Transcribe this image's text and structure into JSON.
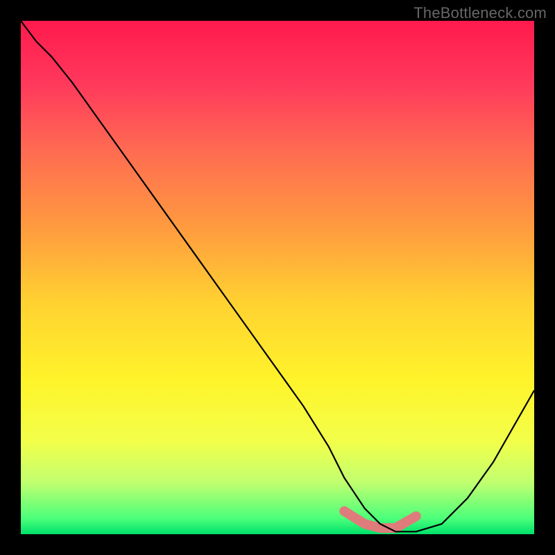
{
  "watermark": "TheBottleneck.com",
  "chart_data": {
    "type": "line",
    "title": "",
    "xlabel": "",
    "ylabel": "",
    "xlim": [
      0,
      100
    ],
    "ylim": [
      0,
      100
    ],
    "grid": false,
    "legend": "none",
    "annotations": [],
    "background_gradient": {
      "direction": "vertical",
      "stops": [
        {
          "pos": 0.0,
          "color": "#ff1a4d"
        },
        {
          "pos": 0.12,
          "color": "#ff385c"
        },
        {
          "pos": 0.25,
          "color": "#ff6a52"
        },
        {
          "pos": 0.4,
          "color": "#ff9a3f"
        },
        {
          "pos": 0.55,
          "color": "#ffd231"
        },
        {
          "pos": 0.7,
          "color": "#fff32a"
        },
        {
          "pos": 0.82,
          "color": "#f2ff4a"
        },
        {
          "pos": 0.9,
          "color": "#c0ff70"
        },
        {
          "pos": 0.97,
          "color": "#4aff7a"
        },
        {
          "pos": 1.0,
          "color": "#00e06a"
        }
      ]
    },
    "series": [
      {
        "name": "bottleneck-curve",
        "color": "#000000",
        "x": [
          0,
          3,
          6,
          10,
          15,
          20,
          25,
          30,
          35,
          40,
          45,
          50,
          55,
          60,
          63,
          67,
          70,
          73,
          77,
          82,
          87,
          92,
          96,
          100
        ],
        "y": [
          100,
          96,
          93,
          88,
          81,
          74,
          67,
          60,
          53,
          46,
          39,
          32,
          25,
          17,
          11,
          5,
          2,
          0.5,
          0.5,
          2,
          7,
          14,
          21,
          28
        ]
      }
    ],
    "highlight": {
      "name": "optimal-range",
      "color": "#e07b7b",
      "x": [
        63,
        67,
        70,
        73,
        77
      ],
      "y": [
        4.5,
        2.0,
        1.2,
        1.2,
        3.5
      ]
    }
  }
}
